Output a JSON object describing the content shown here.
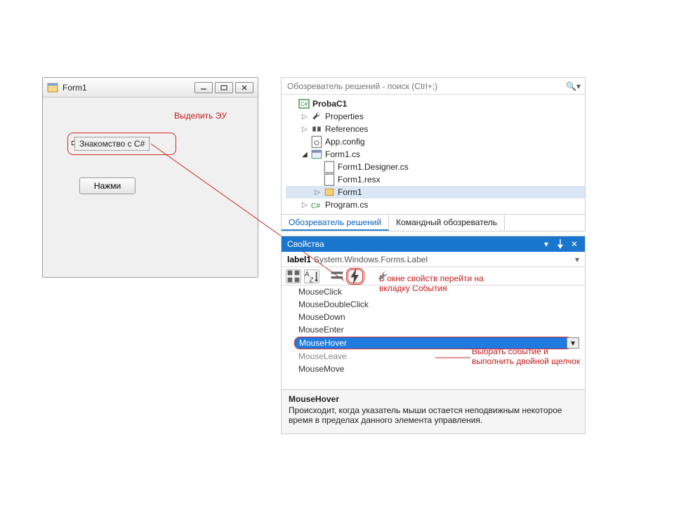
{
  "form": {
    "title": "Form1",
    "label_text": "Знакомство с C#",
    "button_text": "Нажми"
  },
  "annotations": {
    "select_control": "Выделить ЭУ",
    "goto_events": "В окне свойств перейти на вкладку События",
    "dblclick_event": "Выбрать событие и выполнить двойной щелчок"
  },
  "solution_explorer": {
    "search_placeholder": "Обозреватель решений - поиск (Ctrl+;)",
    "project": "ProbaC1",
    "nodes": {
      "properties": "Properties",
      "references": "References",
      "appconfig": "App.config",
      "form1cs": "Form1.cs",
      "form1designer": "Form1.Designer.cs",
      "form1resx": "Form1.resx",
      "form1class": "Form1",
      "programcs": "Program.cs"
    },
    "tabs": {
      "solution": "Обозреватель решений",
      "team": "Командный обозреватель"
    }
  },
  "properties": {
    "title": "Свойства",
    "object_name": "label1",
    "object_type": "System.Windows.Forms.Label",
    "events": [
      "MouseClick",
      "MouseDoubleClick",
      "MouseDown",
      "MouseEnter",
      "MouseHover",
      "MouseLeave",
      "MouseMove"
    ],
    "selected_event": "MouseHover",
    "description_title": "MouseHover",
    "description_text": "Происходит, когда указатель мыши остается неподвижным некоторое время в пределах данного элемента управления."
  }
}
